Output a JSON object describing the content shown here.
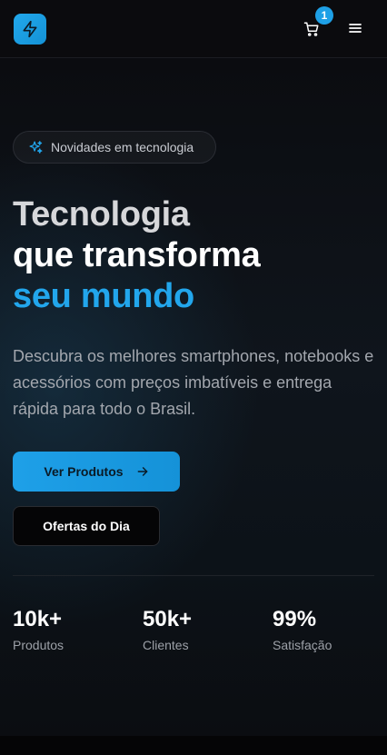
{
  "header": {
    "logo_icon": "lightning-bolt-icon",
    "cart_icon": "shopping-cart-icon",
    "cart_count": "1",
    "menu_icon": "hamburger-menu-icon"
  },
  "hero": {
    "badge_icon": "sparkles-icon",
    "badge_text": "Novidades em tecnologia",
    "headline_line1": "Tecnologia",
    "headline_line2": "que transforma",
    "headline_line3": "seu mundo",
    "description": "Descubra os melhores smartphones, notebooks e acessórios com preços imbatíveis e entrega rápida para todo o Brasil.",
    "primary_button": "Ver Produtos",
    "primary_button_icon": "arrow-right-icon",
    "secondary_button": "Ofertas do Dia"
  },
  "stats": [
    {
      "value": "10k+",
      "label": "Produtos"
    },
    {
      "value": "50k+",
      "label": "Clientes"
    },
    {
      "value": "99%",
      "label": "Satisfação"
    }
  ],
  "colors": {
    "accent": "#1ea0e8",
    "background": "#0a0a0c",
    "muted_text": "#a3a7ae"
  }
}
